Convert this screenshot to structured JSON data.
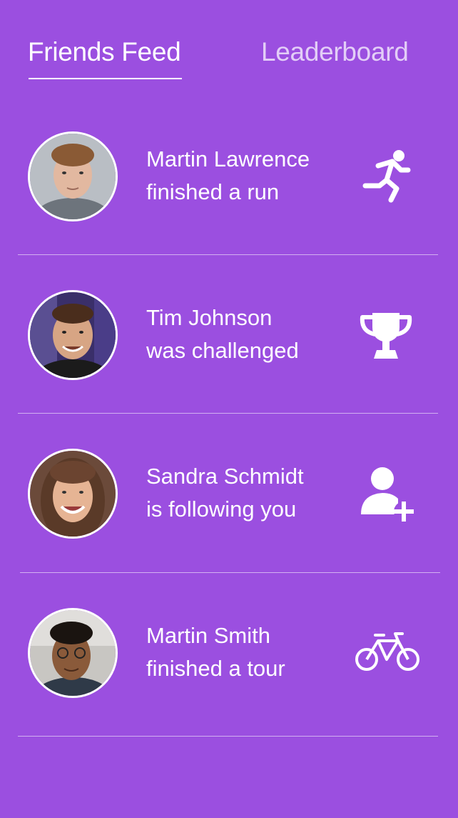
{
  "tabs": {
    "friends_feed": "Friends Feed",
    "leaderboard": "Leaderboard",
    "active": "friends_feed"
  },
  "feed": [
    {
      "name": "Martin Lawrence",
      "action": "finished a run",
      "icon": "running-icon"
    },
    {
      "name": "Tim Johnson",
      "action": "was challenged",
      "icon": "trophy-icon"
    },
    {
      "name": "Sandra Schmidt",
      "action": "is following you",
      "icon": "add-user-icon"
    },
    {
      "name": "Martin Smith",
      "action": "finished a tour",
      "icon": "bicycle-icon"
    }
  ],
  "colors": {
    "background": "#9b4fe0",
    "text": "#ffffff"
  }
}
